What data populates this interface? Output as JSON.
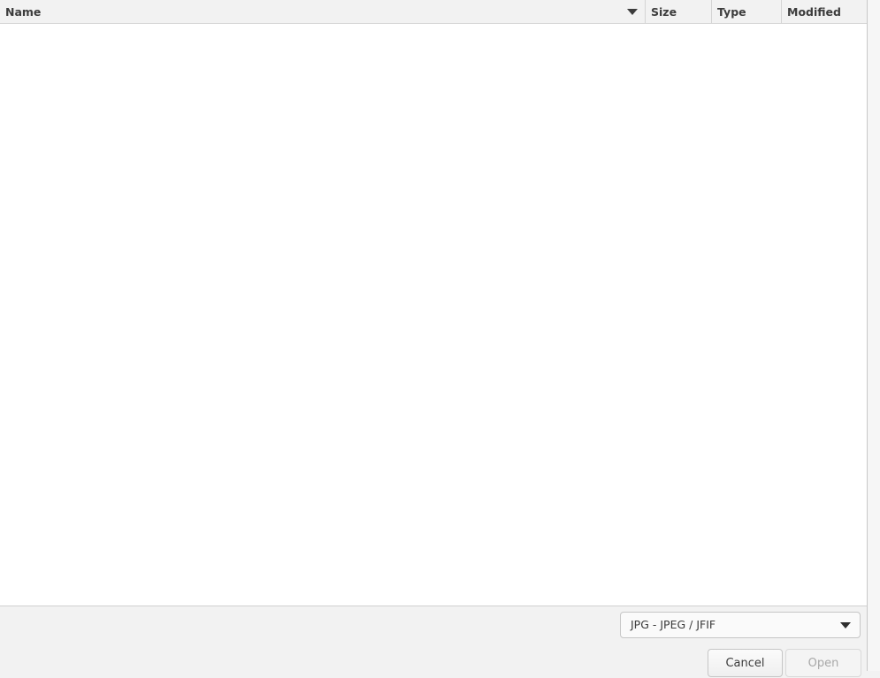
{
  "file_list": {
    "columns": [
      {
        "label": "Name"
      },
      {
        "label": "Size"
      },
      {
        "label": "Type"
      },
      {
        "label": "Modified"
      }
    ],
    "sort_indicator": "chevron-down-icon",
    "rows": []
  },
  "filter": {
    "selected": "JPG - JPEG / JFIF",
    "arrow_icon": "chevron-down-icon"
  },
  "buttons": {
    "cancel_label": "Cancel",
    "open_label": "Open",
    "open_enabled": false
  }
}
